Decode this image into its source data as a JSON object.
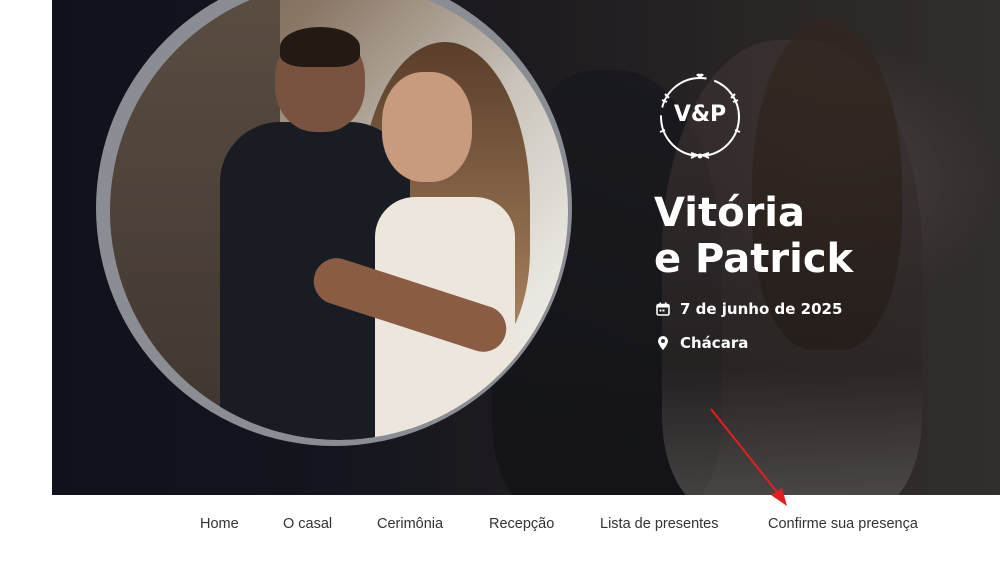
{
  "couple": {
    "monogram": "V&P",
    "name_line1": "Vitória",
    "name_line2": "e Patrick"
  },
  "event": {
    "date": "7 de junho de 2025",
    "location": "Chácara"
  },
  "icons": {
    "date": "calendar-icon",
    "location": "map-pin-icon"
  },
  "nav": {
    "items": [
      {
        "label": "Home"
      },
      {
        "label": "O casal"
      },
      {
        "label": "Cerimônia"
      },
      {
        "label": "Recepção"
      },
      {
        "label": "Lista de presentes"
      },
      {
        "label": "Confirme sua presença"
      }
    ]
  },
  "colors": {
    "hero_text": "#ffffff",
    "nav_text": "#333333",
    "annotation_arrow": "#e02020"
  }
}
